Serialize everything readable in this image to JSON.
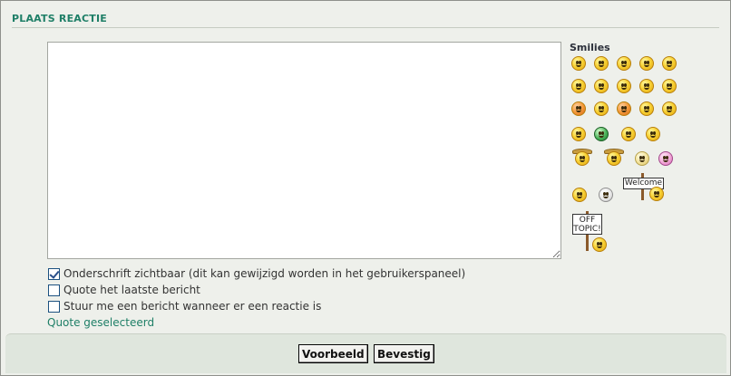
{
  "section": {
    "title": "PLAATS REACTIE"
  },
  "editor": {
    "value": ""
  },
  "smilies": {
    "title": "Smilies",
    "welcome_sign": "Welcome",
    "offtopic_sign_line1": "OFF",
    "offtopic_sign_line2": "TOPIC!"
  },
  "options": {
    "signature_label": "Onderschrift zichtbaar (dit kan gewijzigd worden in het gebruikerspaneel)",
    "signature_checked": true,
    "quote_last_label": "Quote het laatste bericht",
    "quote_last_checked": false,
    "notify_label": "Stuur me een bericht wanneer er een reactie is",
    "notify_checked": false
  },
  "links": {
    "quote_selected": "Quote geselecteerd"
  },
  "buttons": {
    "preview": "Voorbeeld",
    "submit": "Bevestig"
  },
  "colors": {
    "accent_green": "#1f7f67",
    "background": "#eef0eb",
    "bottom_bar": "#dfe6dd"
  }
}
